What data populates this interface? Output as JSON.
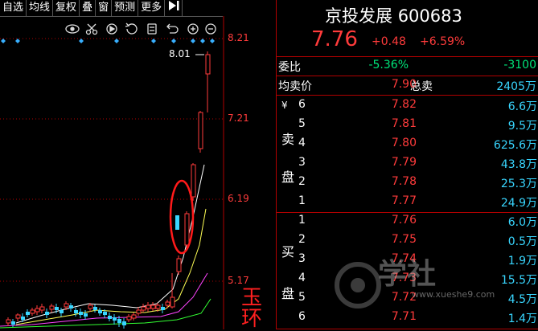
{
  "toolbar": {
    "buttons": [
      "自选",
      "均线",
      "复权",
      "叠",
      "窗",
      "预测",
      "更多"
    ],
    "arrow_icon": "collapse-right-icon"
  },
  "chart": {
    "icons": [
      "eye-icon",
      "scissors-icon",
      "play-icon",
      "refresh-icon",
      "settings-icon",
      "undo-icon",
      "zoom-in-icon",
      "zoom-out-icon"
    ],
    "price_ticks": [
      "8.21",
      "7.21",
      "6.19",
      "5.17"
    ],
    "high_marker": "8.01",
    "annotation": "玉环",
    "colors": {
      "up": "#ff3b3b",
      "down": "#38d6ff",
      "ma5": "#ffffff",
      "ma10": "#ffff55",
      "ma20": "#ff44ff",
      "ma60": "#33ff33",
      "grid": "#b00000"
    }
  },
  "quote": {
    "name": "京投发展",
    "code": "600683",
    "last": "7.76",
    "change": "+0.48",
    "change_pct": "+6.59%",
    "weibi_label": "委比",
    "weibi_pct": "-5.36%",
    "weibi_diff": "-3100",
    "avg_ask_label": "均卖价",
    "avg_ask": "7.90",
    "total_ask_label": "总卖",
    "total_ask": "2405万",
    "ask_side_chars": [
      "¥",
      "卖",
      "盘"
    ],
    "bid_side_chars": [
      "买",
      "盘"
    ],
    "asks": [
      {
        "level": "6",
        "price": "7.82",
        "vol": "6.6万"
      },
      {
        "level": "5",
        "price": "7.81",
        "vol": "9.5万"
      },
      {
        "level": "4",
        "price": "7.80",
        "vol": "625.6万"
      },
      {
        "level": "3",
        "price": "7.79",
        "vol": "43.8万"
      },
      {
        "level": "2",
        "price": "7.78",
        "vol": "25.3万"
      },
      {
        "level": "1",
        "price": "7.77",
        "vol": "24.9万"
      }
    ],
    "bids": [
      {
        "level": "1",
        "price": "7.76",
        "vol": "6.0万"
      },
      {
        "level": "2",
        "price": "7.75",
        "vol": "0.5万"
      },
      {
        "level": "3",
        "price": "7.74",
        "vol": "1.9万"
      },
      {
        "level": "4",
        "price": "7.73",
        "vol": "15.5万"
      },
      {
        "level": "5",
        "price": "7.72",
        "vol": "4.5万"
      },
      {
        "level": "6",
        "price": "7.71",
        "vol": "1.4万"
      }
    ]
  },
  "watermark": {
    "brand": "学社",
    "url": "www.xueshe9.com"
  }
}
